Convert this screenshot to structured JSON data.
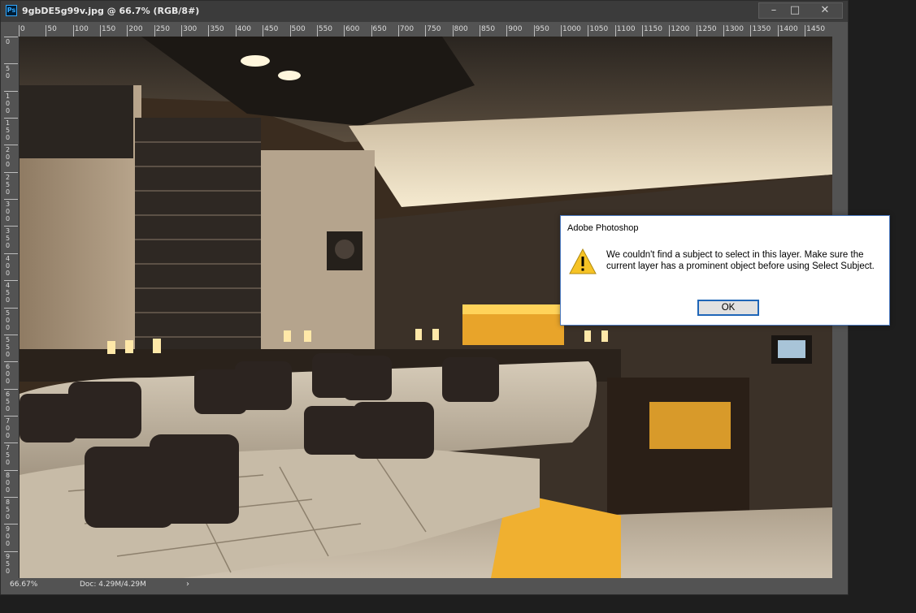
{
  "window": {
    "app_badge": "Ps",
    "title": "9gbDE5g99v.jpg @ 66.7% (RGB/8#)",
    "min_glyph": "–",
    "max_glyph": "□",
    "close_glyph": "✕"
  },
  "ruler_top": [
    "0",
    "50",
    "100",
    "150",
    "200",
    "250",
    "300",
    "350",
    "400",
    "450",
    "500",
    "550",
    "600",
    "650",
    "700",
    "750",
    "800",
    "850",
    "900",
    "950",
    "1000",
    "1050",
    "1100",
    "1150",
    "1200",
    "1250",
    "1300",
    "1350",
    "1400",
    "1450"
  ],
  "ruler_left": [
    "0",
    "50",
    "100",
    "150",
    "200",
    "250",
    "300",
    "350",
    "400",
    "450",
    "500",
    "550",
    "600",
    "650",
    "700",
    "750",
    "800",
    "850",
    "900",
    "950"
  ],
  "status": {
    "zoom": "66.67%",
    "doc": "Doc: 4.29M/4.29M",
    "arrow": "›"
  },
  "dialog": {
    "title": "Adobe Photoshop",
    "icon": "warning-icon",
    "message": "We couldn't find a subject to select in this layer. Make sure the current layer has a prominent object before using Select Subject.",
    "ok_label": "OK"
  },
  "colors": {
    "ps_blue": "#31a8ff",
    "warning_yellow": "#f6c325",
    "dialog_border": "#4c7ac0",
    "ok_focus": "#1f66b8"
  }
}
